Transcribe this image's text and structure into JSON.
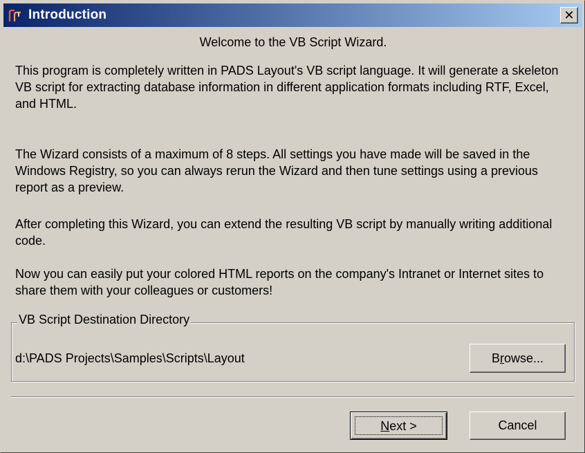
{
  "window": {
    "title": "Introduction",
    "close_glyph": "✕",
    "icon": "pads-app-icon"
  },
  "content": {
    "welcome": "Welcome to the VB Script Wizard.",
    "paragraphs": [
      "This program is completely written in PADS Layout's VB script language. It will generate a skeleton VB script for extracting database information in different application formats including RTF, Excel, and HTML.",
      "The Wizard consists of a maximum of 8 steps. All settings you have made will be saved in the Windows Registry, so you can always rerun the Wizard and then tune settings using a previous report as a preview.",
      "After completing this Wizard, you can extend the resulting VB script by manually writing additional code.",
      "Now you can easily put your colored HTML reports on the company's Intranet or Internet sites to share them with your colleagues or customers!"
    ]
  },
  "destination": {
    "group_label": "VB Script Destination Directory",
    "path": "d:\\PADS Projects\\Samples\\Scripts\\Layout",
    "browse_label_pre": "B",
    "browse_label_key": "r",
    "browse_label_post": "owse..."
  },
  "footer": {
    "next_key": "N",
    "next_post": "ext >",
    "cancel_label": "Cancel"
  },
  "colors": {
    "titlebar_start": "#0a246a",
    "titlebar_end": "#a6caf0",
    "face": "#d4d0c8"
  }
}
